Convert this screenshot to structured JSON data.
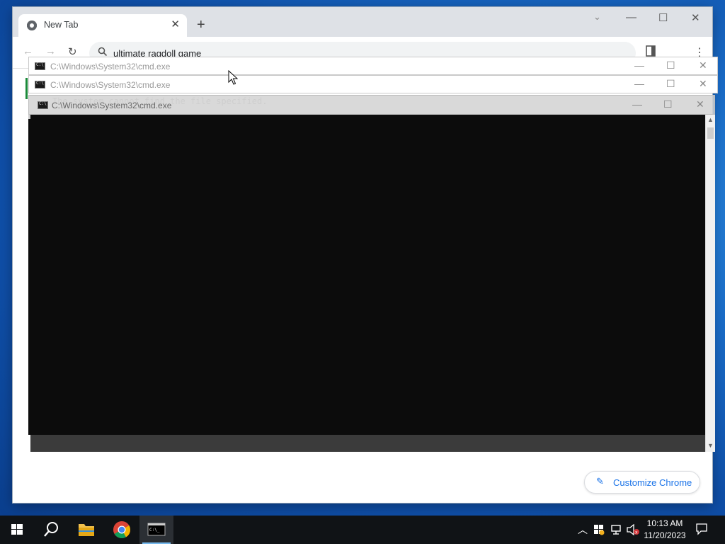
{
  "chrome": {
    "tab_title": "New Tab",
    "tab_close": "✕",
    "new_tab": "+",
    "tab_search": "⌄",
    "minimize": "—",
    "maximize": "☐",
    "close": "✕",
    "back": "←",
    "forward": "→",
    "reload": "↻",
    "address_value": "ultimate ragdoll game",
    "customize_label": "Customize Chrome",
    "more_menu": "⋮"
  },
  "cmd_windows": [
    {
      "title": "C:\\Windows\\System32\\cmd.exe"
    },
    {
      "title": "C:\\Windows\\System32\\cmd.exe"
    },
    {
      "title": "C:\\Windows\\System32\\cmd.exe",
      "console_text": "The system cannot find the file specified."
    }
  ],
  "cmd_controls": {
    "minimize": "—",
    "maximize": "☐",
    "close": "✕"
  },
  "taskbar": {
    "time": "10:13 AM",
    "date": "11/20/2023",
    "tray_chevron": "︿"
  },
  "colors": {
    "accent": "#1a73e8",
    "taskbar": "#101316",
    "console_bg": "#0c0c0c"
  }
}
